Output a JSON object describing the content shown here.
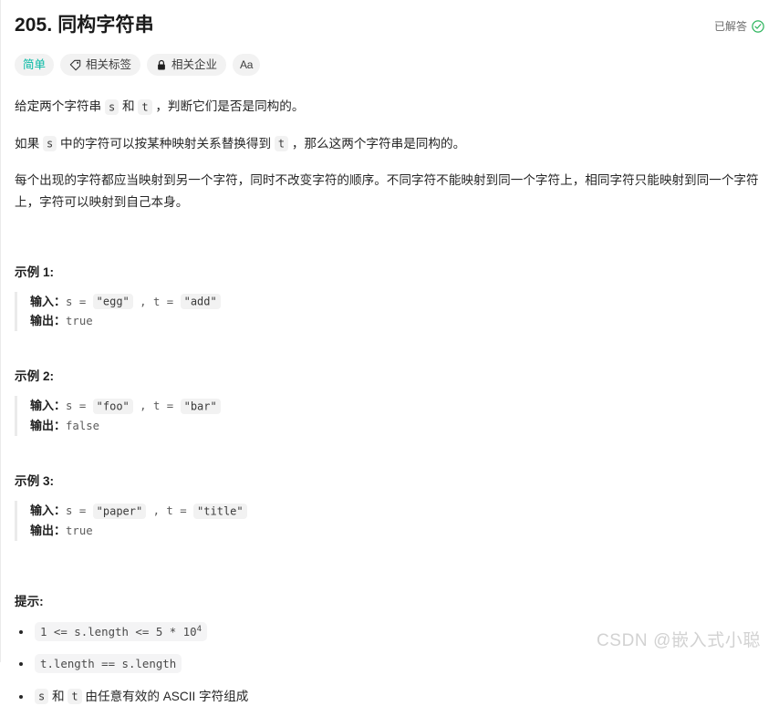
{
  "header": {
    "title": "205. 同构字符串",
    "status_label": "已解答",
    "status_icon": "check-circle-icon",
    "status_color": "#2db55d"
  },
  "tags": [
    {
      "label": "简单",
      "icon": null,
      "name": "difficulty-badge",
      "color": "#00b8a3"
    },
    {
      "label": "相关标签",
      "icon": "tag-icon",
      "name": "related-topics-button"
    },
    {
      "label": "相关企业",
      "icon": "lock-icon",
      "name": "related-companies-button"
    },
    {
      "label": "Aa",
      "icon": "font-size-icon",
      "name": "font-size-button"
    }
  ],
  "description": {
    "p1": {
      "a": "给定两个字符串 ",
      "code1": "s",
      "b": " 和 ",
      "code2": "t",
      "c": " ，判断它们是否是同构的。"
    },
    "p2": {
      "a": "如果 ",
      "code1": "s",
      "b": " 中的字符可以按某种映射关系替换得到 ",
      "code2": "t",
      "c": " ，那么这两个字符串是同构的。"
    },
    "p3": "每个出现的字符都应当映射到另一个字符，同时不改变字符的顺序。不同字符不能映射到同一个字符上，相同字符只能映射到同一个字符上，字符可以映射到自己本身。"
  },
  "examples": [
    {
      "title": "示例 1:",
      "input_label": "输入：",
      "input_prefix": "s = ",
      "input_s": "\"egg\"",
      "input_mid": " , t = ",
      "input_t": "\"add\"",
      "output_label": "输出：",
      "output_value": "true"
    },
    {
      "title": "示例 2:",
      "input_label": "输入：",
      "input_prefix": "s = ",
      "input_s": "\"foo\"",
      "input_mid": " , t = ",
      "input_t": "\"bar\"",
      "output_label": "输出：",
      "output_value": "false"
    },
    {
      "title": "示例 3:",
      "input_label": "输入：",
      "input_prefix": "s = ",
      "input_s": "\"paper\"",
      "input_mid": " , t = ",
      "input_t": "\"title\"",
      "output_label": "输出：",
      "output_value": "true"
    }
  ],
  "constraints": {
    "title": "提示:",
    "items": [
      {
        "type": "code",
        "base": "1 <= s.length <= 5 * 10",
        "sup": "4"
      },
      {
        "type": "code",
        "base": "t.length == s.length",
        "sup": ""
      },
      {
        "type": "mixed",
        "code1": "s",
        "a": " 和 ",
        "code2": "t",
        "b": " 由任意有效的 ASCII 字符组成"
      }
    ]
  },
  "watermark": "CSDN @嵌入式小聪"
}
